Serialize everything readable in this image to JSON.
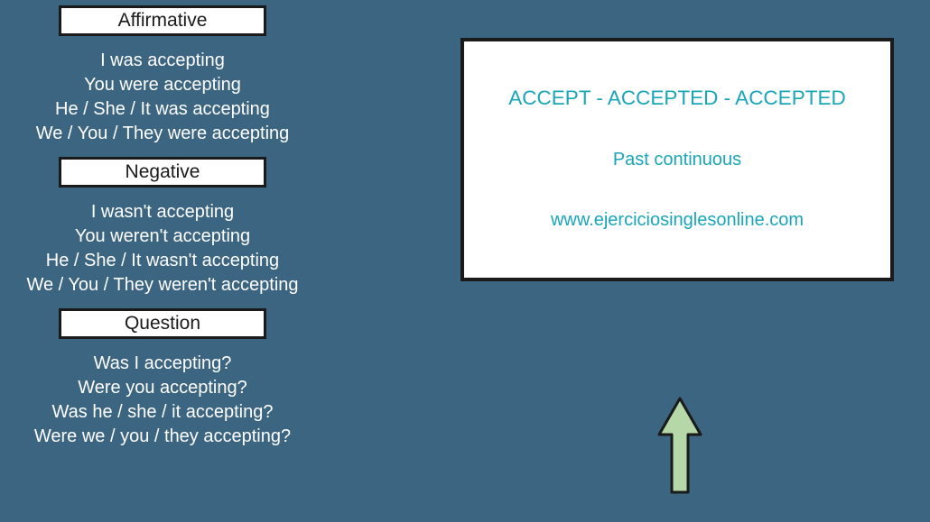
{
  "sections": {
    "affirmative": {
      "label": "Affirmative",
      "lines": [
        "I was accepting",
        "You were accepting",
        "He / She / It was accepting",
        "We / You  / They were accepting"
      ]
    },
    "negative": {
      "label": "Negative",
      "lines": [
        "I wasn't accepting",
        "You weren't accepting",
        "He / She / It wasn't accepting",
        "We / You  / They weren't accepting"
      ]
    },
    "question": {
      "label": "Question",
      "lines": [
        "Was I accepting?",
        "Were you accepting?",
        "Was he / she / it accepting?",
        "Were we / you  / they accepting?"
      ]
    }
  },
  "info": {
    "title": "ACCEPT - ACCEPTED - ACCEPTED",
    "subtitle": "Past continuous",
    "url": "www.ejerciciosinglesonline.com"
  }
}
